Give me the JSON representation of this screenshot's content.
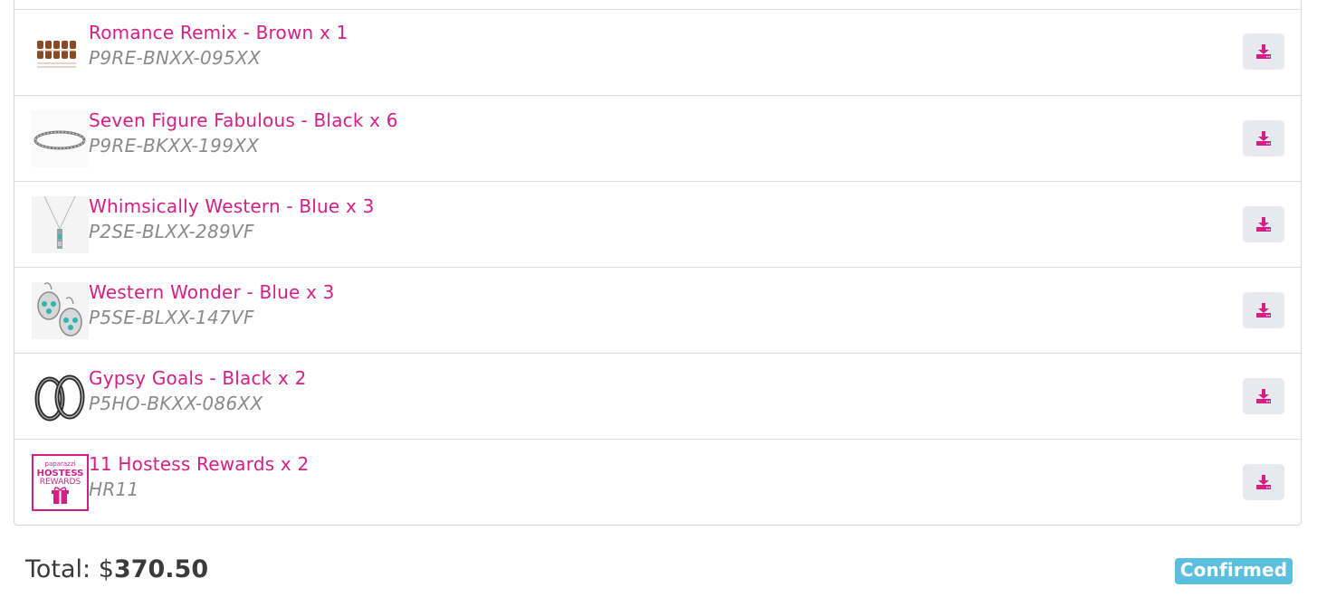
{
  "items": [
    {
      "title": "Romance Remix - Brown x 1",
      "sku": "P9RE-BNXX-095XX",
      "thumb": "bracelet-brown-thumbnail"
    },
    {
      "title": "Seven Figure Fabulous - Black x 6",
      "sku": "P9RE-BKXX-199XX",
      "thumb": "bracelet-silver-thumbnail"
    },
    {
      "title": "Whimsically Western - Blue x 3",
      "sku": "P2SE-BLXX-289VF",
      "thumb": "necklace-thumbnail"
    },
    {
      "title": "Western Wonder - Blue x 3",
      "sku": "P5SE-BLXX-147VF",
      "thumb": "earrings-thumbnail"
    },
    {
      "title": "Gypsy Goals - Black x 2",
      "sku": "P5HO-BKXX-086XX",
      "thumb": "hoop-earrings-thumbnail"
    },
    {
      "title": "11 Hostess Rewards x 2",
      "sku": "HR11",
      "thumb": "hostess-rewards-thumbnail"
    }
  ],
  "hostess_logo": {
    "brand": "paparazzi",
    "line1": "HOSTESS",
    "line2": "REWARDS"
  },
  "download_icon": "download-icon",
  "total": {
    "label": "Total: $",
    "amount": "370.50"
  },
  "status": "Confirmed",
  "colors": {
    "accent": "#d51f85",
    "sku": "#8a8a8a",
    "badge": "#5bc0de",
    "button_bg": "#e8e9ee"
  }
}
